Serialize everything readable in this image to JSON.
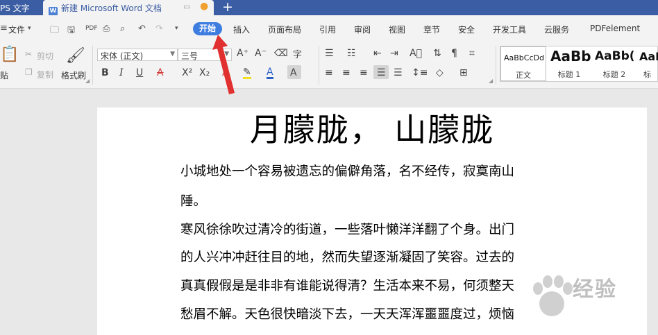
{
  "titlebar": {
    "app_tab": "PS 文字",
    "doc_tab": "新建 Microsoft Word 文档",
    "doc_tab_icon": "W"
  },
  "menu": {
    "file": "文件",
    "start": "开始",
    "items": [
      "插入",
      "页面布局",
      "引用",
      "审阅",
      "视图",
      "章节",
      "安全",
      "开发工具",
      "云服务",
      "PDFelement"
    ]
  },
  "ribbon": {
    "paste": "贴",
    "cut": "剪切",
    "copy": "复制",
    "format_painter": "格式刷",
    "font_name": "宋体 (正文)",
    "font_size": "三号",
    "styles": [
      {
        "sample": "AaBbCcDd",
        "label": "正文"
      },
      {
        "sample": "AaBb",
        "label": "标题 1"
      },
      {
        "sample": "AaBb(",
        "label": "标题 2"
      },
      {
        "sample": "AaB",
        "label": "标"
      }
    ]
  },
  "document": {
    "title": "月朦胧， 山朦胧",
    "lines": [
      "小城地处一个容易被遗忘的偏僻角落，名不经传，寂寞南山",
      "陲。",
      "寒风徐徐吹过清冷的街道，一些落叶懒洋洋翻了个身。出门",
      "的人兴冲冲赶往目的地，然而失望逐渐凝固了笑容。过去的",
      "真真假假是是非非有谁能说得清？生活本来不易，何须整天",
      "愁眉不解。天色很快暗淡下去，一天天浑浑噩噩度过，烦恼"
    ]
  },
  "watermark": {
    "text": "经验"
  },
  "colors": {
    "titlebar": "#3b5da3",
    "accent": "#3d7de0",
    "annotation_arrow": "#e03030"
  }
}
